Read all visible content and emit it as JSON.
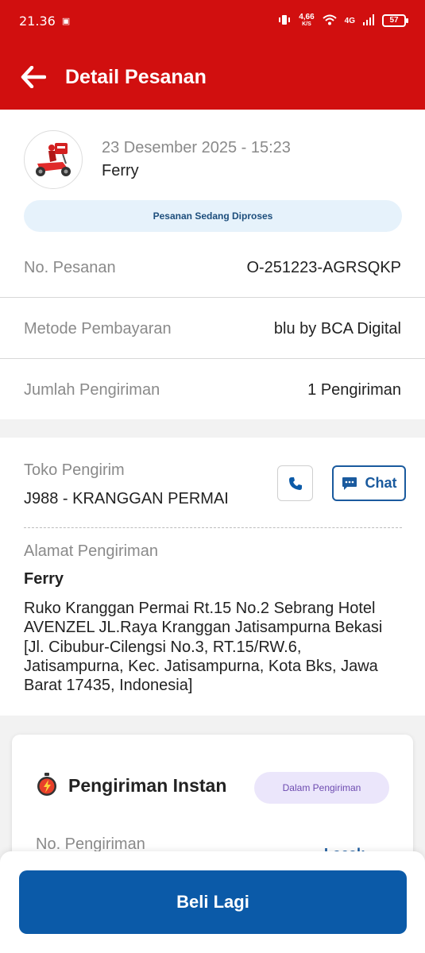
{
  "status_bar": {
    "time": "21.36",
    "net_speed_value": "4,66",
    "net_speed_unit": "K/S",
    "network": "4G",
    "battery": "57"
  },
  "app_bar": {
    "title": "Detail Pesanan",
    "back_icon": "arrow-left-icon"
  },
  "order": {
    "date": "23 Desember 2025 - 15:23",
    "service": "Ferry",
    "status": "Pesanan Sedang Diproses",
    "rows": [
      {
        "label": "No. Pesanan",
        "value": "O-251223-AGRSQKP"
      },
      {
        "label": "Metode Pembayaran",
        "value": "blu by BCA Digital"
      },
      {
        "label": "Jumlah Pengiriman",
        "value": "1 Pengiriman"
      }
    ]
  },
  "store": {
    "label": "Toko Pengirim",
    "name": "J988 - KRANGGAN PERMAI",
    "chat_label": "Chat"
  },
  "address": {
    "label": "Alamat Pengiriman",
    "name": "Ferry",
    "text": "Ruko Kranggan Permai Rt.15 No.2 Sebrang Hotel AVENZEL JL.Raya Kranggan Jatisampurna Bekasi [Jl. Cibubur-Cilengsi No.3, RT.15/RW.6, Jatisampurna, Kec. Jatisampurna, Kota Bks, Jawa Barat 17435, Indonesia]"
  },
  "delivery": {
    "title": "Pengiriman Instan",
    "status": "Dalam Pengiriman",
    "number_label": "No. Pengiriman",
    "link_label": "Lacak"
  },
  "footer": {
    "buy_again_label": "Beli Lagi"
  },
  "colors": {
    "brand_red": "#d10f0f",
    "primary_blue": "#0b5aa8",
    "status_blue_bg": "#e6f2fb",
    "status_purple_bg": "#ebe6fb"
  }
}
